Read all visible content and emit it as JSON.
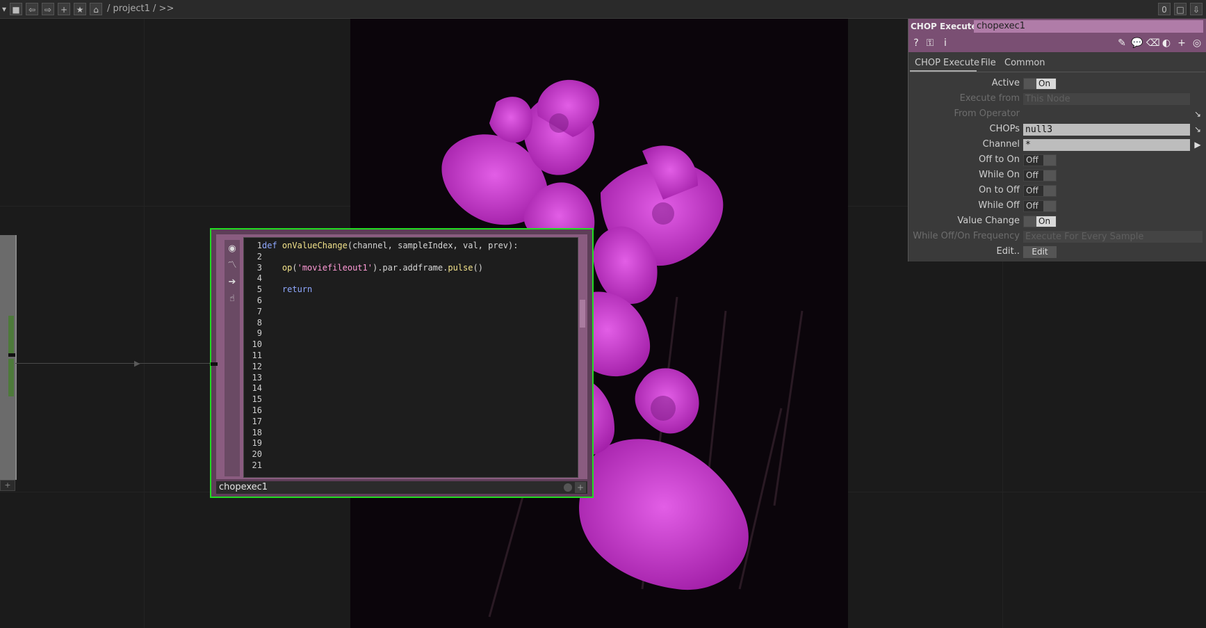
{
  "topbar": {
    "path": "/ project1 / >>",
    "right_counter": "0",
    "buttons": [
      "stop-icon",
      "back-icon",
      "forward-icon",
      "plus-icon",
      "star-icon",
      "home-icon"
    ]
  },
  "dat_node": {
    "name": "chopexec1",
    "lines": [
      {
        "n": "1",
        "code": "def onValueChange(channel, sampleIndex, val, prev):"
      },
      {
        "n": "2",
        "code": ""
      },
      {
        "n": "3",
        "code": "    op('moviefileout1').par.addframe.pulse()"
      },
      {
        "n": "4",
        "code": ""
      },
      {
        "n": "5",
        "code": "    return"
      },
      {
        "n": "6",
        "code": ""
      },
      {
        "n": "7",
        "code": ""
      },
      {
        "n": "8",
        "code": ""
      },
      {
        "n": "9",
        "code": ""
      },
      {
        "n": "10",
        "code": ""
      },
      {
        "n": "11",
        "code": ""
      },
      {
        "n": "12",
        "code": ""
      },
      {
        "n": "13",
        "code": ""
      },
      {
        "n": "14",
        "code": ""
      },
      {
        "n": "15",
        "code": ""
      },
      {
        "n": "16",
        "code": ""
      },
      {
        "n": "17",
        "code": ""
      },
      {
        "n": "18",
        "code": ""
      },
      {
        "n": "19",
        "code": ""
      },
      {
        "n": "20",
        "code": ""
      },
      {
        "n": "21",
        "code": ""
      }
    ]
  },
  "panel": {
    "type_label": "CHOP Execute",
    "op_name": "chopexec1",
    "tabs": [
      "CHOP Execute",
      "File",
      "Common"
    ],
    "params": {
      "active": {
        "label": "Active",
        "value": "On"
      },
      "execute_from": {
        "label": "Execute from",
        "value": "This Node"
      },
      "from_operator": {
        "label": "From Operator",
        "value": ""
      },
      "chops": {
        "label": "CHOPs",
        "value": "null3"
      },
      "channel": {
        "label": "Channel",
        "value": "*"
      },
      "off_to_on": {
        "label": "Off to On",
        "value": "Off"
      },
      "while_on": {
        "label": "While On",
        "value": "Off"
      },
      "on_to_off": {
        "label": "On to Off",
        "value": "Off"
      },
      "while_off": {
        "label": "While Off",
        "value": "Off"
      },
      "value_change": {
        "label": "Value Change",
        "value": "On"
      },
      "while_freq": {
        "label": "While Off/On Frequency",
        "value": "Execute For Every Sample"
      },
      "edit": {
        "label": "Edit..",
        "value": "Edit"
      }
    }
  },
  "colors": {
    "node_border": "#22dd22",
    "panel_header": "#7a4f73",
    "flower": "#c93bcf"
  }
}
